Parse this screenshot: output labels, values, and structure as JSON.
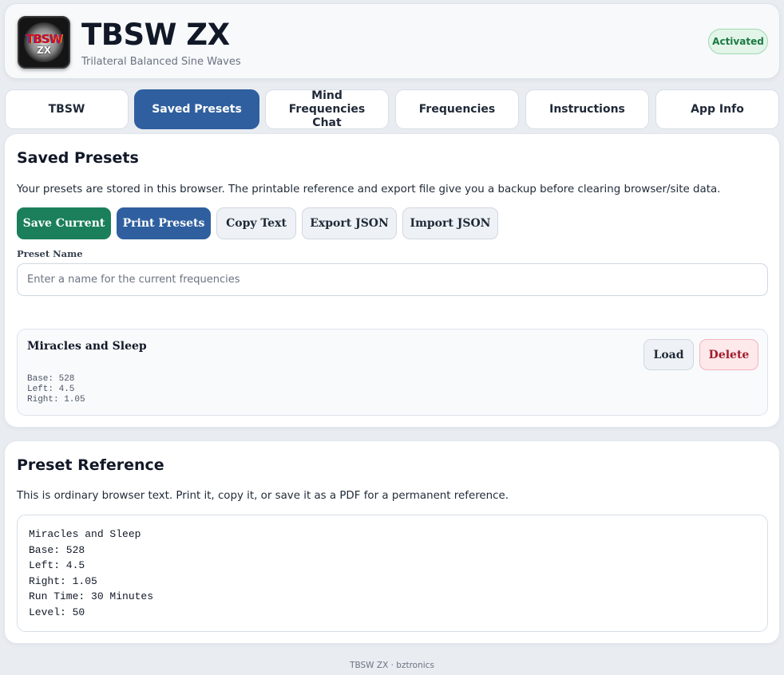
{
  "header": {
    "logo_line1": "TBSW",
    "logo_line2": "ZX",
    "title": "TBSW ZX",
    "subtitle": "Trilateral Balanced Sine Waves",
    "status_badge": "Activated"
  },
  "tabs": [
    {
      "label": "TBSW",
      "active": false
    },
    {
      "label": "Saved Presets",
      "active": true
    },
    {
      "label": "Mind Frequencies Chat",
      "active": false
    },
    {
      "label": "Frequencies",
      "active": false
    },
    {
      "label": "Instructions",
      "active": false
    },
    {
      "label": "App Info",
      "active": false
    }
  ],
  "saved_presets": {
    "title": "Saved Presets",
    "description": "Your presets are stored in this browser. The printable reference and export file give you a backup before clearing browser/site data.",
    "buttons": {
      "save_current": "Save Current",
      "print_presets": "Print Presets",
      "copy_text": "Copy Text",
      "export_json": "Export JSON",
      "import_json": "Import JSON"
    },
    "preset_name_label": "Preset Name",
    "preset_name_placeholder": "Enter a name for the current frequencies",
    "preset_name_value": "",
    "items": [
      {
        "name": "Miracles and Sleep",
        "details": [
          "Base: 528",
          "Left: 4.5",
          "Right: 1.05"
        ],
        "load_label": "Load",
        "delete_label": "Delete"
      }
    ]
  },
  "preset_reference": {
    "title": "Preset Reference",
    "description": "This is ordinary browser text. Print it, copy it, or save it as a PDF for a permanent reference.",
    "lines": [
      "Miracles and Sleep",
      "Base: 528",
      "Left: 4.5",
      "Right: 1.05",
      "Run Time: 30 Minutes",
      "Level: 50"
    ]
  },
  "footer": {
    "text": "TBSW ZX · bztronics"
  },
  "colors": {
    "primary_blue": "#2f5f9e",
    "success_green": "#1a7f5a",
    "danger_red": "#a11c2b",
    "page_background": "#e9edf2"
  }
}
